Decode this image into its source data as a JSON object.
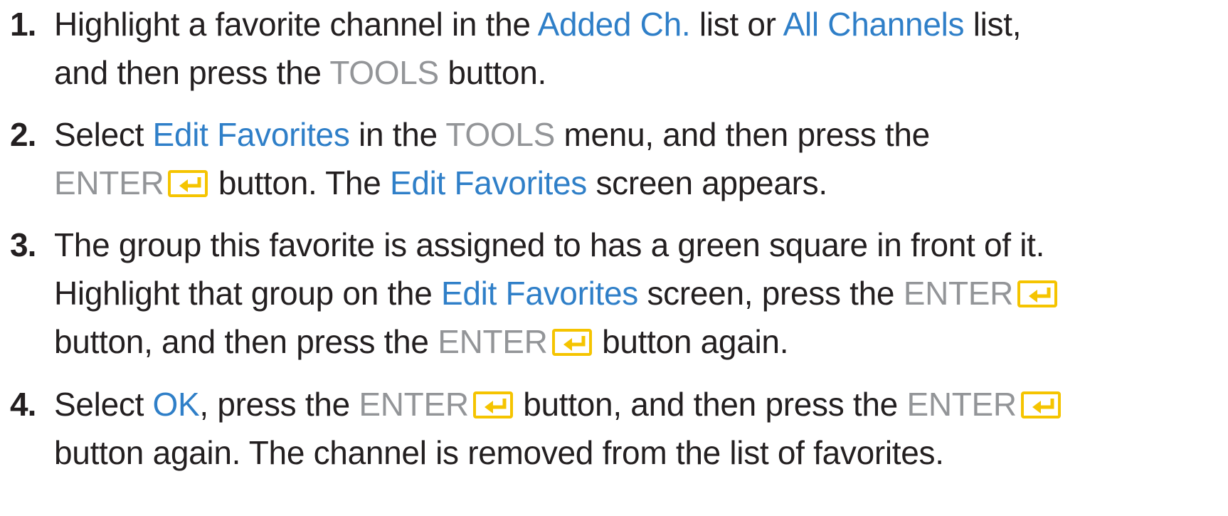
{
  "colors": {
    "text": "#231f20",
    "highlight_blue": "#2f7fc8",
    "button_gray": "#939598",
    "enter_icon_yellow": "#f5c400"
  },
  "icons": {
    "enter": "enter-icon"
  },
  "steps": [
    {
      "number": "1.",
      "lines": [
        [
          "Highlight a favorite channel in the ",
          "Added Ch.",
          " list or ",
          "All Channels",
          " list,"
        ],
        [
          "and then press the ",
          "TOOLS",
          " button."
        ]
      ]
    },
    {
      "number": "2.",
      "lines": [
        [
          "Select ",
          "Edit Favorites",
          " in the ",
          "TOOLS",
          " menu, and then press the"
        ],
        [
          "ENTER",
          " button. The ",
          "Edit Favorites",
          " screen appears."
        ]
      ]
    },
    {
      "number": "3.",
      "lines": [
        [
          "The group this favorite is assigned to has a green square in front of it."
        ],
        [
          "Highlight that group on the ",
          "Edit Favorites",
          " screen, press the ",
          "ENTER"
        ],
        [
          "button, and then press the ",
          "ENTER",
          " button again."
        ]
      ]
    },
    {
      "number": "4.",
      "lines": [
        [
          "Select ",
          "OK",
          ", press the ",
          "ENTER",
          " button, and then press the ",
          "ENTER"
        ],
        [
          "button again. The channel is removed from the list of favorites."
        ]
      ]
    }
  ]
}
